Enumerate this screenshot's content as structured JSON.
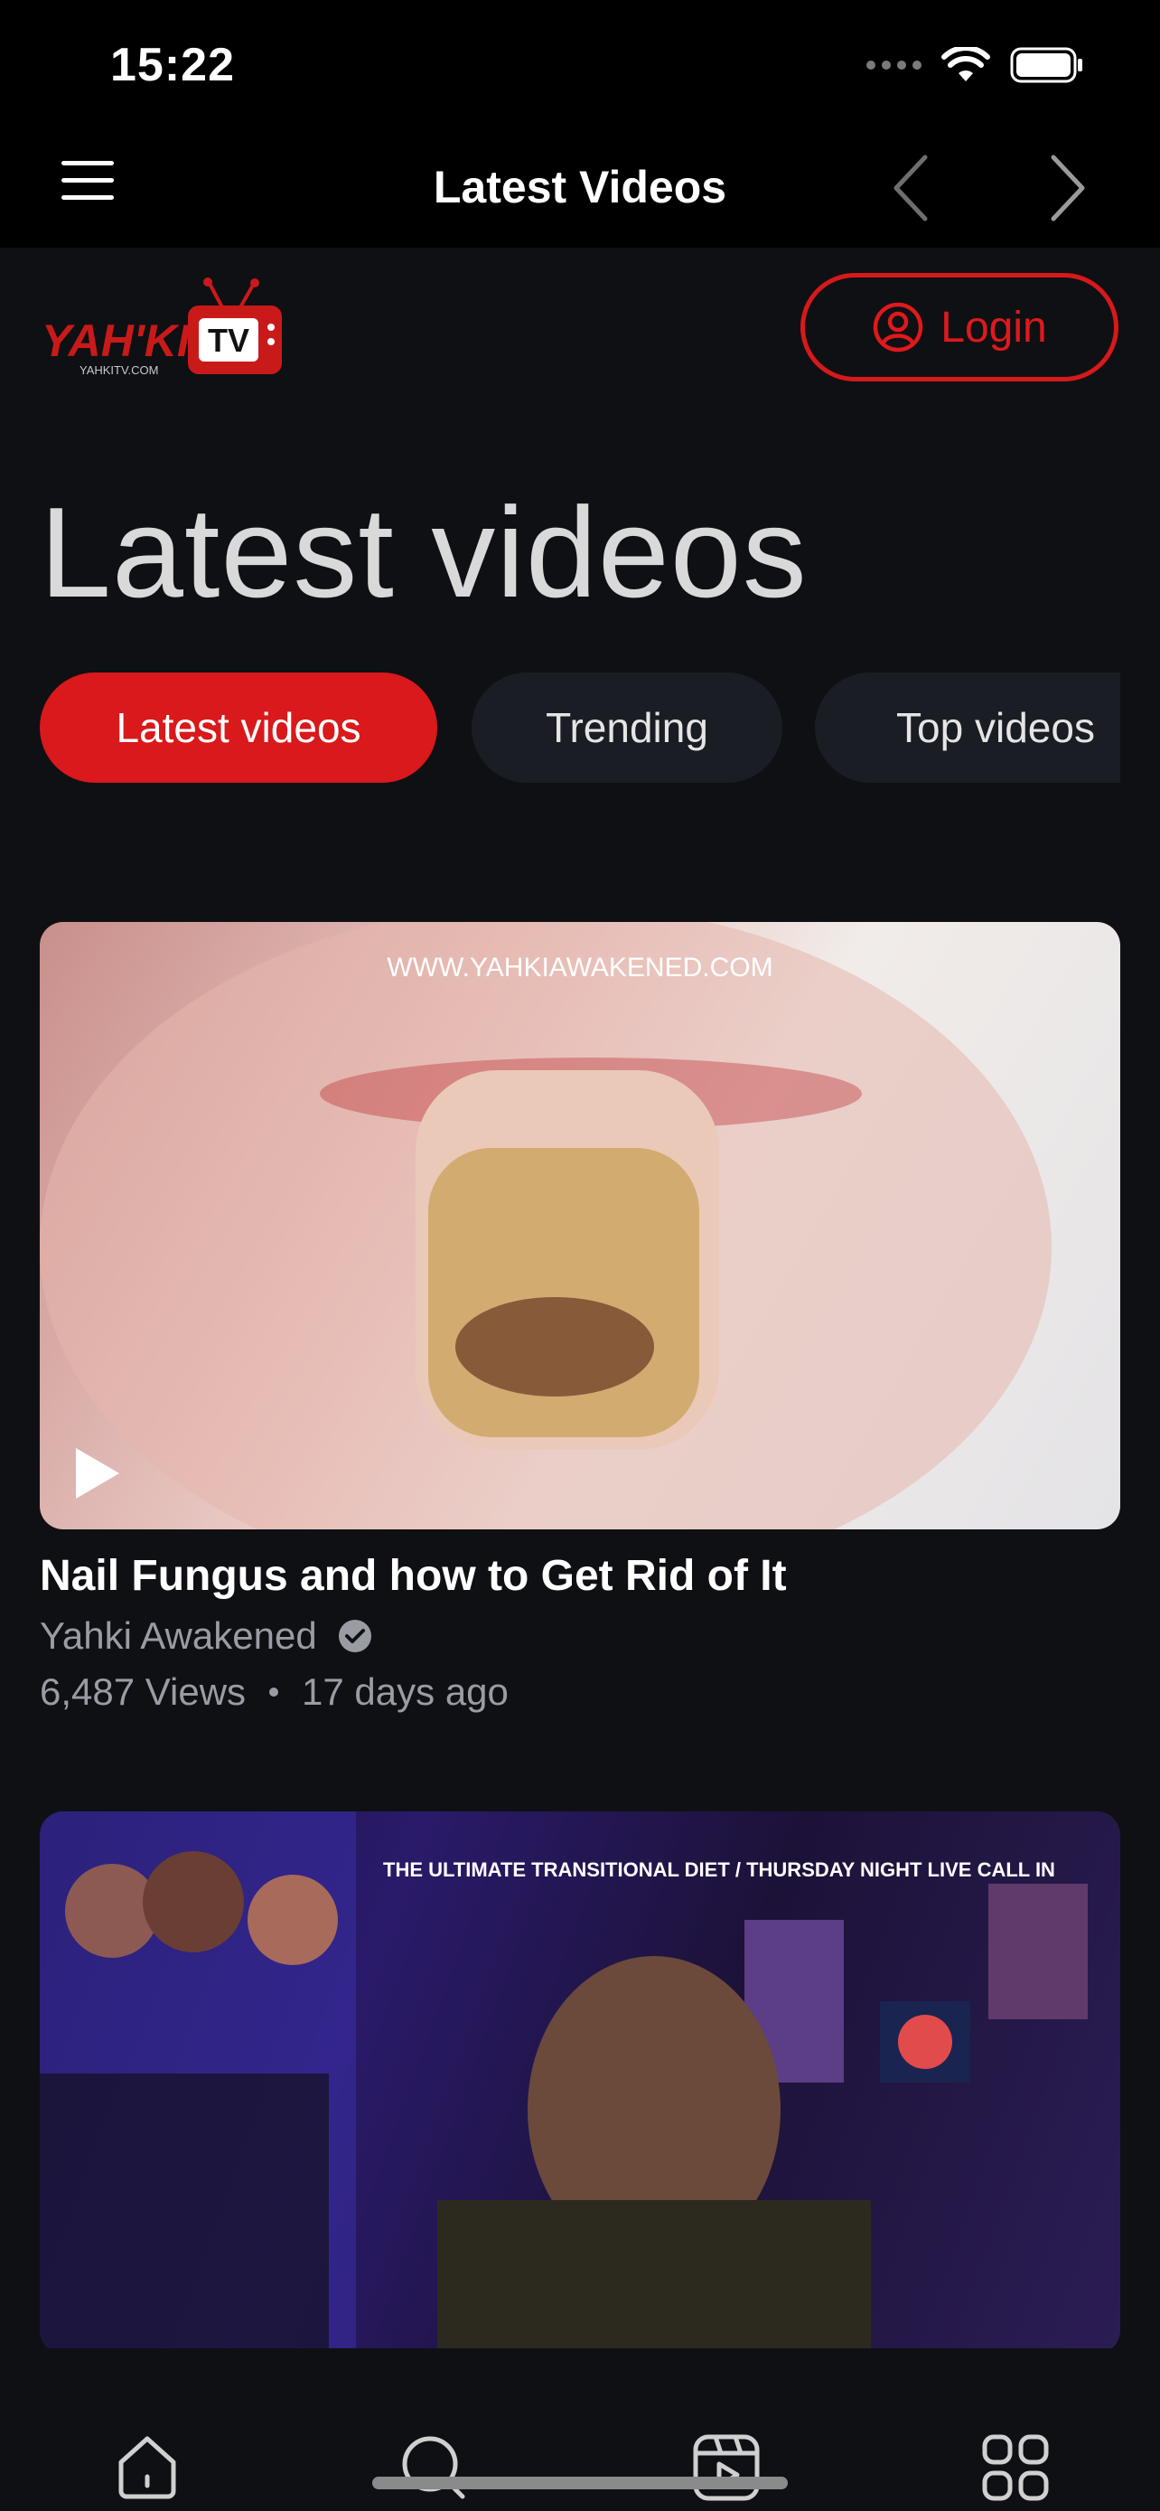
{
  "status_bar": {
    "time": "15:22"
  },
  "nav": {
    "title": "Latest Videos"
  },
  "header": {
    "login_label": "Login"
  },
  "page": {
    "title": "Latest videos"
  },
  "tabs": [
    {
      "label": "Latest videos",
      "active": true
    },
    {
      "label": "Trending",
      "active": false
    },
    {
      "label": "Top videos",
      "active": false
    }
  ],
  "videos": [
    {
      "thumbnail_caption": "WWW.YAHKIAWAKENED.COM",
      "title": "Nail Fungus and how to Get Rid of It",
      "channel": "Yahki Awakened",
      "verified": true,
      "views": "6,487 Views",
      "age": "17 days ago"
    },
    {
      "thumbnail_caption": "THE ULTIMATE TRANSITIONAL DIET / THURSDAY NIGHT LIVE CALL IN"
    }
  ],
  "colors": {
    "accent": "#d9191b",
    "background": "#0f1014",
    "tab_inactive": "#1b1d24"
  }
}
